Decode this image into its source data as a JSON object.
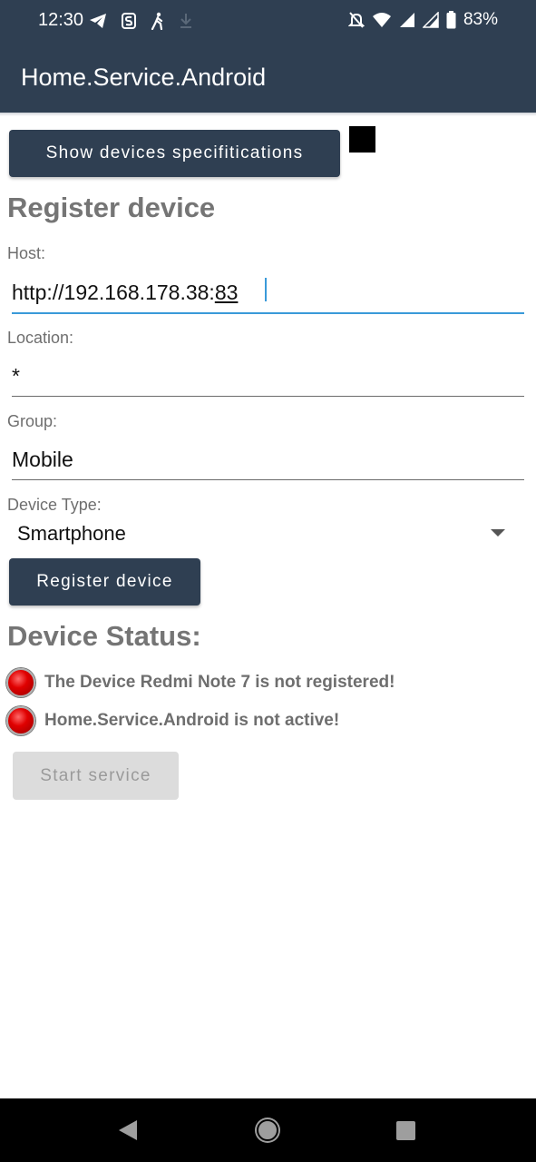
{
  "status_bar": {
    "time": "12:30",
    "battery": "83%",
    "left_icons": [
      "telegram-icon",
      "notification-s-icon",
      "walking-icon",
      "download-icon"
    ],
    "right_icons": [
      "bell-off-icon",
      "wifi-icon",
      "signal-icon",
      "signal-icon",
      "battery-icon"
    ]
  },
  "app_bar": {
    "title": "Home.Service.Android"
  },
  "actions": {
    "show_specs_label": "Show devices specifitications"
  },
  "register": {
    "title": "Register device",
    "host_label": "Host:",
    "host_value": "http://192.168.178.38:",
    "host_value_composing": "83",
    "location_label": "Location:",
    "location_value": "*",
    "group_label": "Group:",
    "group_value": "Mobile",
    "device_type_label": "Device Type:",
    "device_type_value": "Smartphone",
    "register_button_label": "Register device"
  },
  "status": {
    "title": "Device Status:",
    "items": [
      {
        "text": "The Device Redmi Note 7 is not registered!",
        "state": "red"
      },
      {
        "text": "Home.Service.Android is not active!",
        "state": "red"
      }
    ],
    "start_service_label": "Start service"
  },
  "colors": {
    "primary": "#2f3f52",
    "accent": "#3a9ad9",
    "led_red": "#e00000",
    "disabled": "#dcdcdc"
  }
}
